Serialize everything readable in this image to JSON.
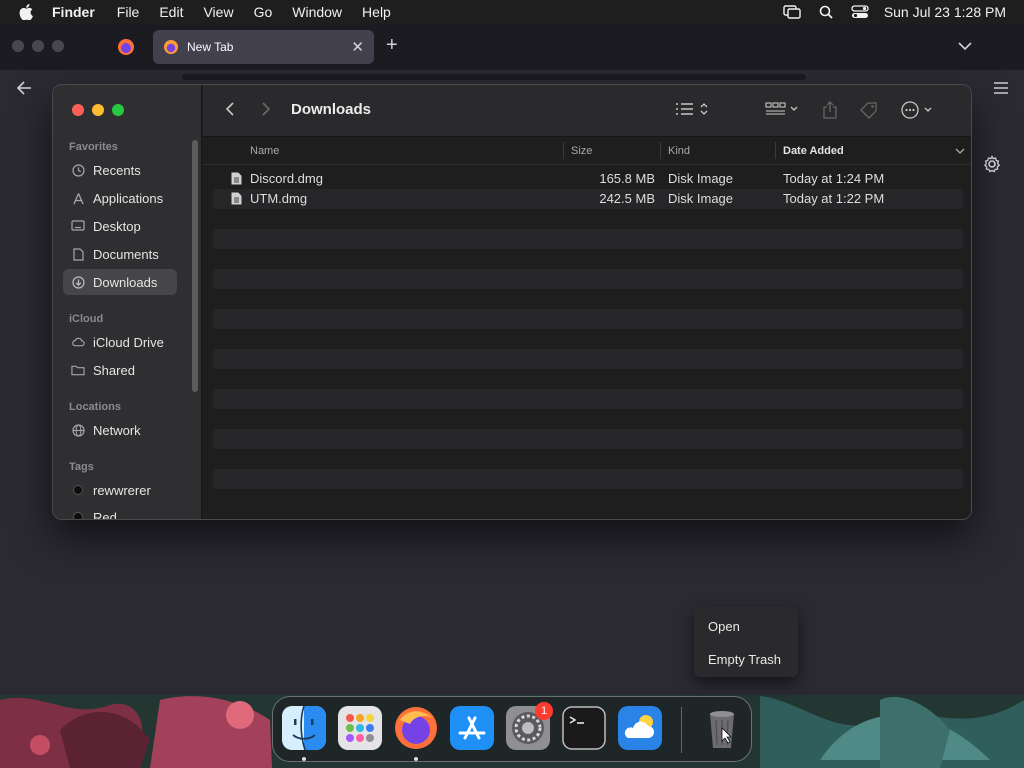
{
  "menubar": {
    "app_name": "Finder",
    "menus": [
      "File",
      "Edit",
      "View",
      "Go",
      "Window",
      "Help"
    ],
    "clock": "Sun Jul 23  1:28 PM"
  },
  "browser": {
    "tab_title": "New Tab"
  },
  "finder": {
    "title": "Downloads",
    "sidebar": {
      "favorites_label": "Favorites",
      "favorites": [
        {
          "label": "Recents",
          "icon": "clock-icon"
        },
        {
          "label": "Applications",
          "icon": "applications-icon"
        },
        {
          "label": "Desktop",
          "icon": "desktop-icon"
        },
        {
          "label": "Documents",
          "icon": "document-icon"
        },
        {
          "label": "Downloads",
          "icon": "download-icon",
          "selected": true
        }
      ],
      "icloud_label": "iCloud",
      "icloud": [
        {
          "label": "iCloud Drive",
          "icon": "cloud-icon"
        },
        {
          "label": "Shared",
          "icon": "shared-folder-icon"
        }
      ],
      "locations_label": "Locations",
      "locations": [
        {
          "label": "Network",
          "icon": "globe-icon"
        }
      ],
      "tags_label": "Tags",
      "tags": [
        {
          "label": "rewwrerer",
          "color": "#0d0d0d"
        },
        {
          "label": "Red",
          "color": "#0d0d0d"
        }
      ]
    },
    "columns": {
      "name": "Name",
      "size": "Size",
      "kind": "Kind",
      "date_added": "Date Added"
    },
    "files": [
      {
        "name": "Discord.dmg",
        "size": "165.8 MB",
        "kind": "Disk Image",
        "date_added": "Today at 1:24 PM"
      },
      {
        "name": "UTM.dmg",
        "size": "242.5 MB",
        "kind": "Disk Image",
        "date_added": "Today at 1:22 PM"
      }
    ]
  },
  "context_menu": {
    "items": [
      "Open",
      "Empty Trash"
    ]
  },
  "dock": {
    "apps": [
      "Finder",
      "Launchpad",
      "Firefox",
      "App Store",
      "System Settings",
      "Terminal",
      "Weather",
      "Trash"
    ],
    "system_settings_badge": "1"
  },
  "colors": {
    "accent_red": "#ff5f57",
    "accent_yellow": "#febc2e",
    "accent_green": "#28c840",
    "badge": "#ff3b30"
  }
}
